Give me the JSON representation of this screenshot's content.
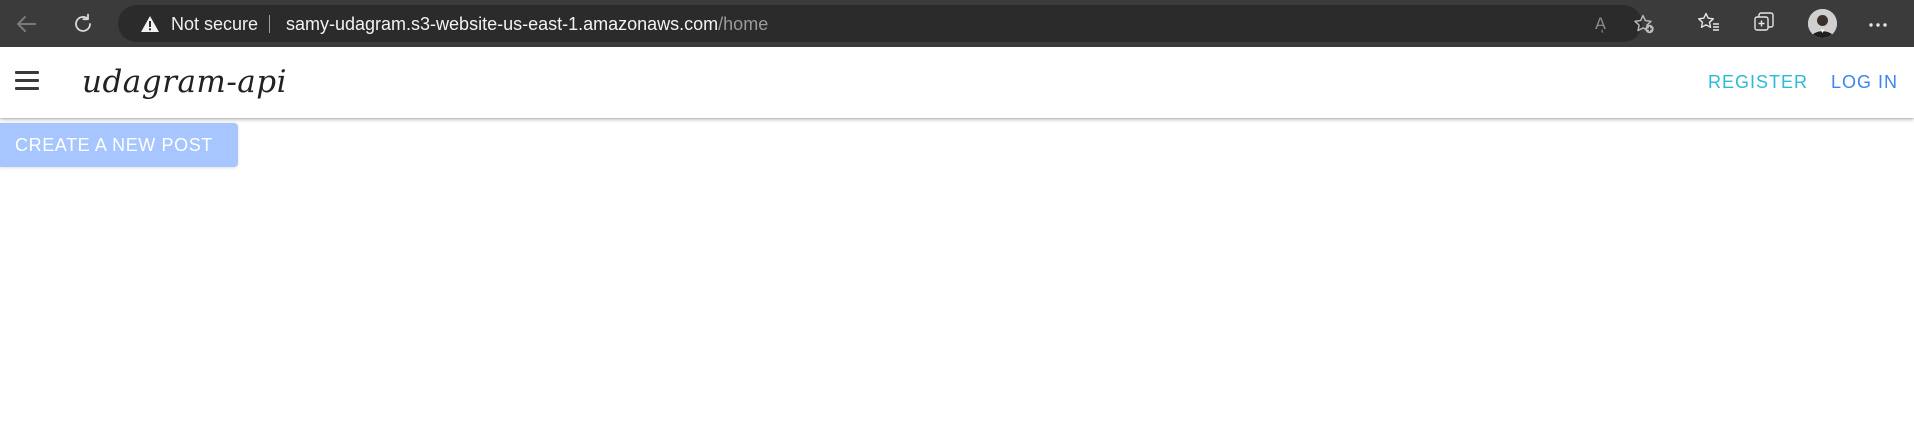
{
  "browser": {
    "security_label": "Not secure",
    "url_host": "samy-udagram.s3-website-us-east-1.amazonaws.com",
    "url_path": "/home",
    "read_aloud_glyph": "Aͅ"
  },
  "header": {
    "brand": "udagram-api",
    "register_label": "REGISTER",
    "login_label": "LOG IN"
  },
  "main": {
    "create_post_label": "CREATE A NEW POST"
  },
  "colors": {
    "browser_bar": "#3b3b3b",
    "address_bar": "#2b2b2b",
    "register_link": "#2bbad8",
    "login_link": "#3a86f0",
    "create_button": "#a7c6ff"
  },
  "icons": [
    "back-arrow-icon",
    "refresh-icon",
    "warning-icon",
    "read-aloud-icon",
    "add-favorite-icon",
    "favorites-icon",
    "collections-icon",
    "profile-avatar",
    "more-options-icon",
    "hamburger-menu-icon"
  ]
}
